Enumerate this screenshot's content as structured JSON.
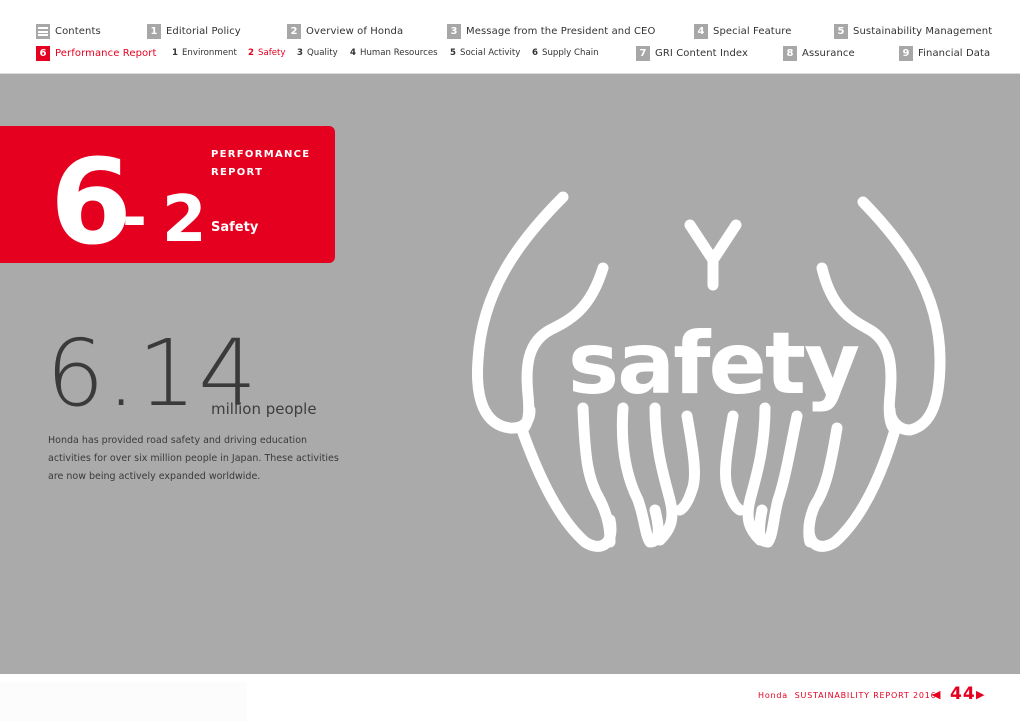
{
  "nav": {
    "row1": [
      {
        "badge": "",
        "icon": "menu-icon",
        "label": "Contents"
      },
      {
        "badge": "1",
        "label": "Editorial Policy"
      },
      {
        "badge": "2",
        "label": "Overview of Honda"
      },
      {
        "badge": "3",
        "label": "Message from the President and CEO"
      },
      {
        "badge": "4",
        "label": "Special Feature"
      },
      {
        "badge": "5",
        "label": "Sustainability Management"
      }
    ],
    "row2": [
      {
        "badge": "6",
        "label": "Performance Report",
        "active": true
      },
      {
        "badge": "7",
        "label": "GRI Content Index"
      },
      {
        "badge": "8",
        "label": "Assurance"
      },
      {
        "badge": "9",
        "label": "Financial Data"
      }
    ],
    "sub_items": [
      {
        "num": "1",
        "label": "Environment"
      },
      {
        "num": "2",
        "label": "Safety",
        "active": true
      },
      {
        "num": "3",
        "label": "Quality"
      },
      {
        "num": "4",
        "label": "Human Resources"
      },
      {
        "num": "5",
        "label": "Social Activity"
      },
      {
        "num": "6",
        "label": "Supply Chain"
      }
    ]
  },
  "section": {
    "chapter": "6",
    "dash": "-",
    "sub": "2",
    "label_line1": "PERFORMANCE",
    "label_line2": "REPORT",
    "title": "Safety"
  },
  "stat": {
    "value": "6.14",
    "unit": "million people",
    "description": "Honda has provided road safety and driving education activities for over six million people in Japan. These activities are now being actively expanded worldwide."
  },
  "illustration": {
    "word": "safety",
    "icon": "hands-holding-icon"
  },
  "footer": {
    "brand": "Honda",
    "report": "SUSTAINABILITY REPORT 2016",
    "page": "44",
    "prev": "◀",
    "next": "▶"
  },
  "colors": {
    "accent": "#e60020",
    "panel": "#aaaaaa",
    "badge": "#a7a7a7"
  }
}
